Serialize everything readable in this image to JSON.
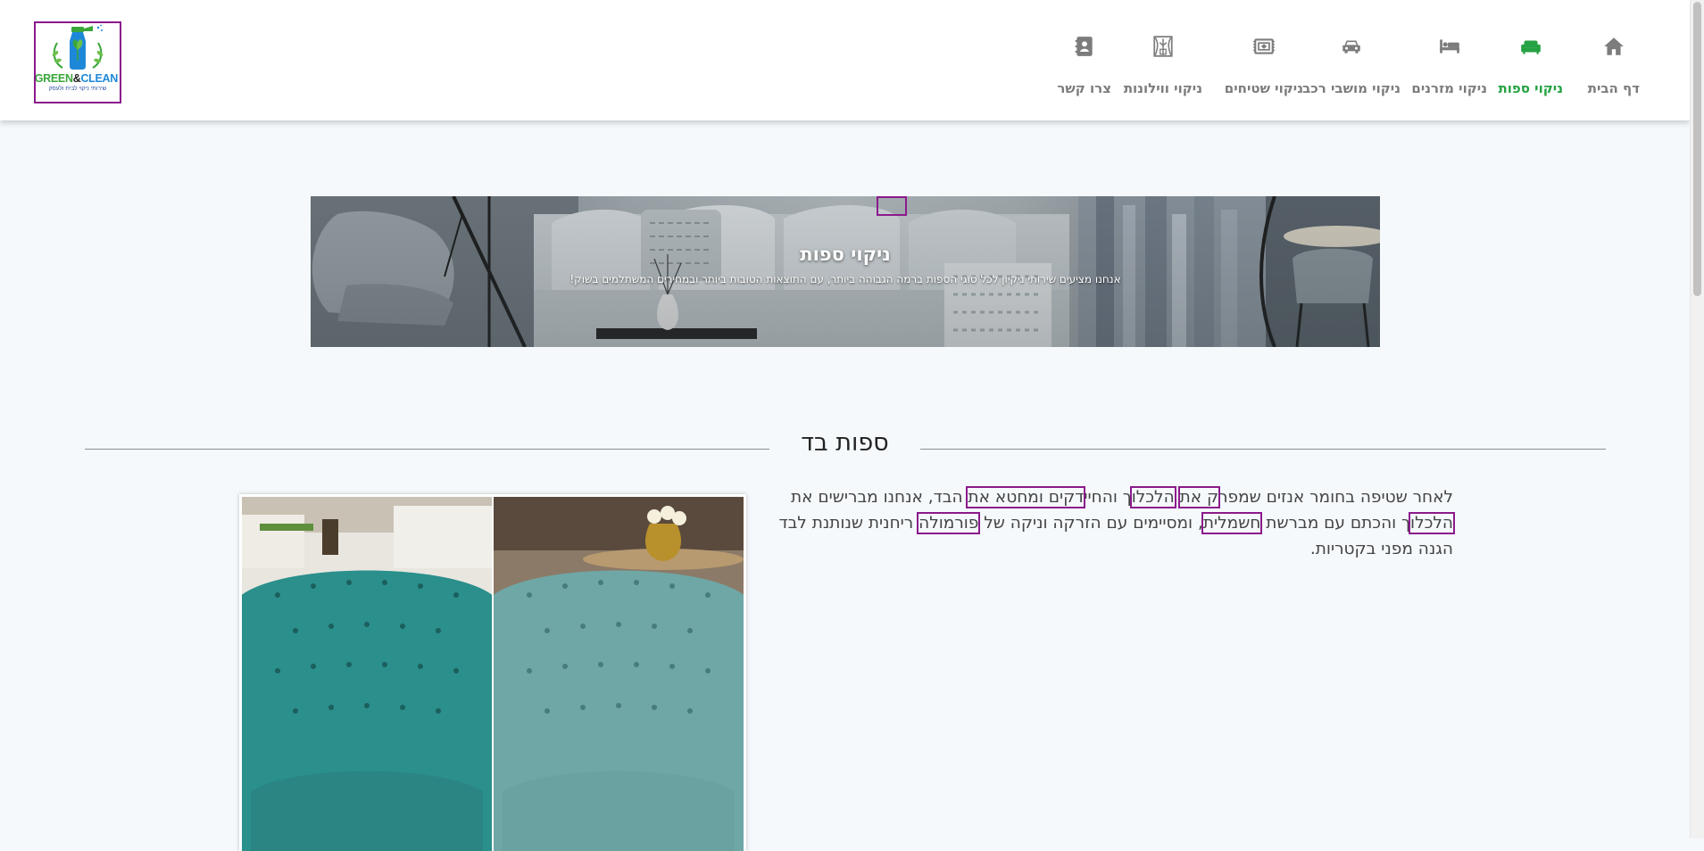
{
  "brand": {
    "logo_name": "GREEN",
    "logo_amp": "&",
    "logo_clean": "CLEAN",
    "logo_tagline": "שירותי ניקוי לבית ולעסק",
    "colors": {
      "green": "#25a243",
      "blue": "#1e88d8",
      "highlight": "#8b1a8b"
    }
  },
  "nav": {
    "items": [
      {
        "label": "דף הבית",
        "icon": "home-icon",
        "active": false
      },
      {
        "label": "ניקוי ספות",
        "icon": "sofa-icon",
        "active": true
      },
      {
        "label": "ניקוי מזרנים",
        "icon": "bed-icon",
        "active": false
      },
      {
        "label": "ניקוי מושבי רכב",
        "icon": "car-icon",
        "active": false
      },
      {
        "label": "ניקוי שטיחים",
        "icon": "rug-icon",
        "active": false
      },
      {
        "label": "ניקוי ווילונות",
        "icon": "curtain-icon",
        "active": false
      },
      {
        "label": "צרו קשר",
        "icon": "contact-book-icon",
        "active": false
      }
    ]
  },
  "hero": {
    "title": "ניקוי ספות",
    "subtitle": "אנחנו מציעים שירותי ניקיון לכל סוגי הספות ברמה הגבוהה ביותר, עם התוצאות הטובות ביותר ובמחירים המשתלמים בשוק!"
  },
  "section": {
    "title": "ספות בד",
    "paragraph": {
      "p1": "לאחר שטיפה בחומר אנזים שמפר",
      "h1": "ק את",
      "p2": " ",
      "h2": "הלכלו",
      "p3": "ך והחיי",
      "h3": "דקים ומחטא את",
      "p4": " הבד, אנחנו מברישים את ",
      "h4": "הלכלו",
      "p5": "ך והכתם עם מברשת ",
      "h5": "חשמלית",
      "p6": ", ומסיימים עם הזרקה וניקה של ",
      "h6": "פורמולה",
      "p7": " ריחנית שנותנת לבד הגנה מפני בקטריות."
    }
  }
}
